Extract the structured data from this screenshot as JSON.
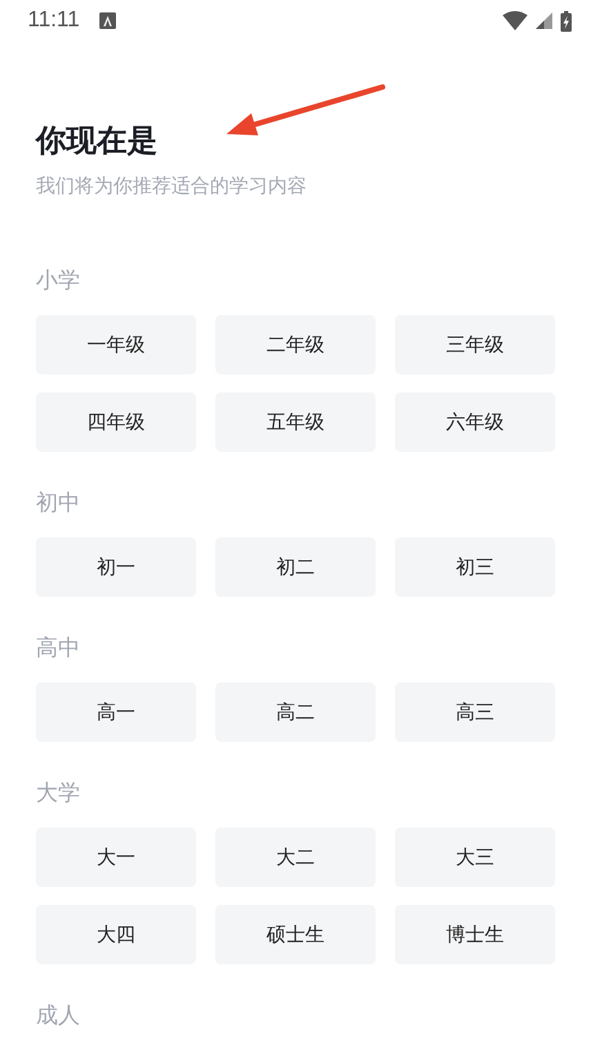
{
  "status_bar": {
    "time": "11:11"
  },
  "title": "你现在是",
  "subtitle": "我们将为你推荐适合的学习内容",
  "sections": [
    {
      "heading": "小学",
      "options": [
        {
          "label": "一年级",
          "selected": false
        },
        {
          "label": "二年级",
          "selected": false
        },
        {
          "label": "三年级",
          "selected": false
        },
        {
          "label": "四年级",
          "selected": false
        },
        {
          "label": "五年级",
          "selected": false
        },
        {
          "label": "六年级",
          "selected": false
        }
      ]
    },
    {
      "heading": "初中",
      "options": [
        {
          "label": "初一",
          "selected": false
        },
        {
          "label": "初二",
          "selected": false
        },
        {
          "label": "初三",
          "selected": false
        }
      ]
    },
    {
      "heading": "高中",
      "options": [
        {
          "label": "高一",
          "selected": false
        },
        {
          "label": "高二",
          "selected": false
        },
        {
          "label": "高三",
          "selected": false
        }
      ]
    },
    {
      "heading": "大学",
      "options": [
        {
          "label": "大一",
          "selected": false
        },
        {
          "label": "大二",
          "selected": false
        },
        {
          "label": "大三",
          "selected": false
        },
        {
          "label": "大四",
          "selected": false
        },
        {
          "label": "硕士生",
          "selected": false
        },
        {
          "label": "博士生",
          "selected": false
        }
      ]
    },
    {
      "heading": "成人"
    }
  ]
}
